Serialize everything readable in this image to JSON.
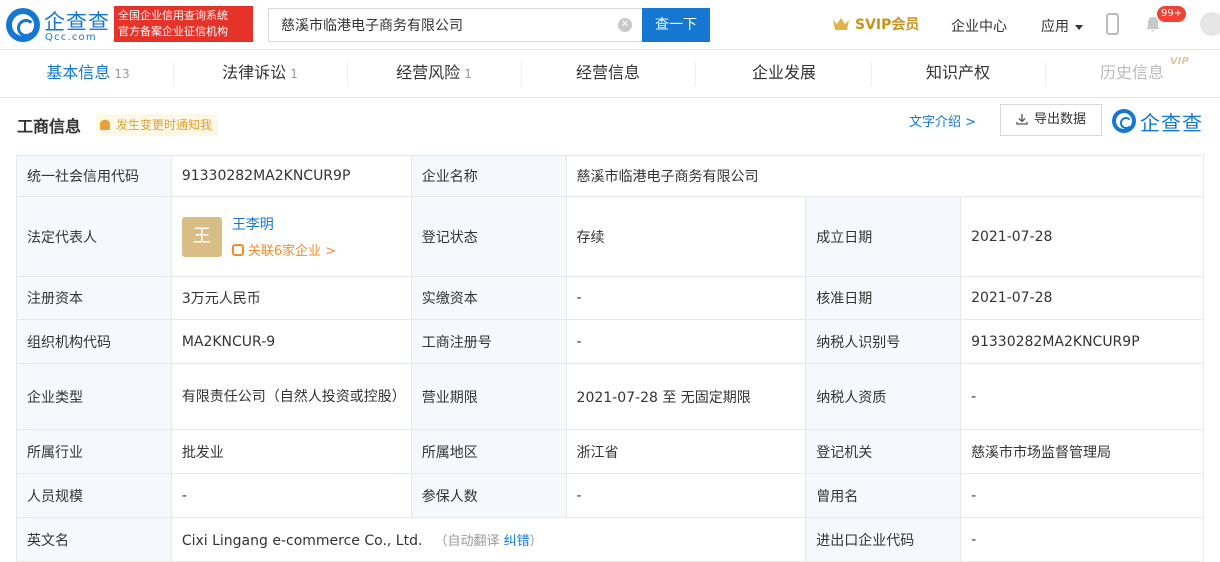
{
  "header": {
    "logo_cn": "企查查",
    "logo_en": "Qcc.com",
    "badge_line1": "全国企业信用查询系统",
    "badge_line2": "官方备案企业征信机构",
    "search_value": "慈溪市临港电子商务有限公司",
    "search_button": "查一下",
    "svip_label": "SVIP会员",
    "enterprise_center": "企业中心",
    "apps_label": "应用",
    "notification_count": "99+"
  },
  "tabs": [
    {
      "label": "基本信息",
      "count": "13"
    },
    {
      "label": "法律诉讼",
      "count": "1"
    },
    {
      "label": "经营风险",
      "count": "1"
    },
    {
      "label": "经营信息",
      "count": ""
    },
    {
      "label": "企业发展",
      "count": ""
    },
    {
      "label": "知识产权",
      "count": ""
    },
    {
      "label": "历史信息",
      "count": "",
      "vip": "VIP"
    }
  ],
  "section": {
    "title": "工商信息",
    "notify": "发生变更时通知我",
    "text_intro": "文字介绍 >",
    "export": "导出数据",
    "brand": "企查查"
  },
  "table": {
    "credit_code_label": "统一社会信用代码",
    "credit_code": "91330282MA2KNCUR9P",
    "company_name_label": "企业名称",
    "company_name": "慈溪市临港电子商务有限公司",
    "legal_rep_label": "法定代表人",
    "legal_rep_avatar": "王",
    "legal_rep_name": "王李明",
    "legal_rep_related": "关联6家企业 >",
    "reg_status_label": "登记状态",
    "reg_status": "存续",
    "found_date_label": "成立日期",
    "found_date": "2021-07-28",
    "reg_capital_label": "注册资本",
    "reg_capital": "3万元人民币",
    "paid_capital_label": "实缴资本",
    "paid_capital": "-",
    "approve_date_label": "核准日期",
    "approve_date": "2021-07-28",
    "org_code_label": "组织机构代码",
    "org_code": "MA2KNCUR-9",
    "biz_reg_no_label": "工商注册号",
    "biz_reg_no": "-",
    "taxpayer_id_label": "纳税人识别号",
    "taxpayer_id": "91330282MA2KNCUR9P",
    "company_type_label": "企业类型",
    "company_type": "有限责任公司（自然人投资或控股）",
    "biz_term_label": "营业期限",
    "biz_term": "2021-07-28 至 无固定期限",
    "taxpayer_qual_label": "纳税人资质",
    "taxpayer_qual": "-",
    "industry_label": "所属行业",
    "industry": "批发业",
    "region_label": "所属地区",
    "region": "浙江省",
    "reg_authority_label": "登记机关",
    "reg_authority": "慈溪市市场监督管理局",
    "staff_size_label": "人员规模",
    "staff_size": "-",
    "insured_label": "参保人数",
    "insured": "-",
    "former_name_label": "曾用名",
    "former_name": "-",
    "en_name_label": "英文名",
    "en_name": "Cixi Lingang e-commerce Co., Ltd.",
    "auto_translate": "（自动翻译",
    "correct_link": "纠错",
    "auto_translate_end": "）",
    "import_export_label": "进出口企业代码",
    "import_export": "-"
  }
}
